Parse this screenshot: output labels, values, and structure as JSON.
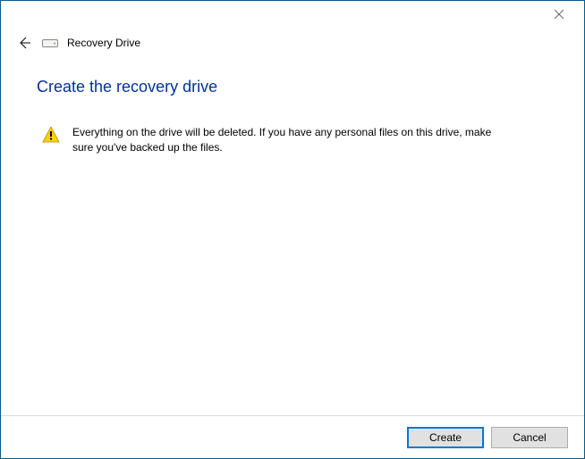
{
  "header": {
    "title": "Recovery Drive"
  },
  "page": {
    "heading": "Create the recovery drive",
    "warning_text": "Everything on the drive will be deleted. If you have any personal files on this drive, make sure you've backed up the files."
  },
  "footer": {
    "create_label": "Create",
    "cancel_label": "Cancel"
  }
}
